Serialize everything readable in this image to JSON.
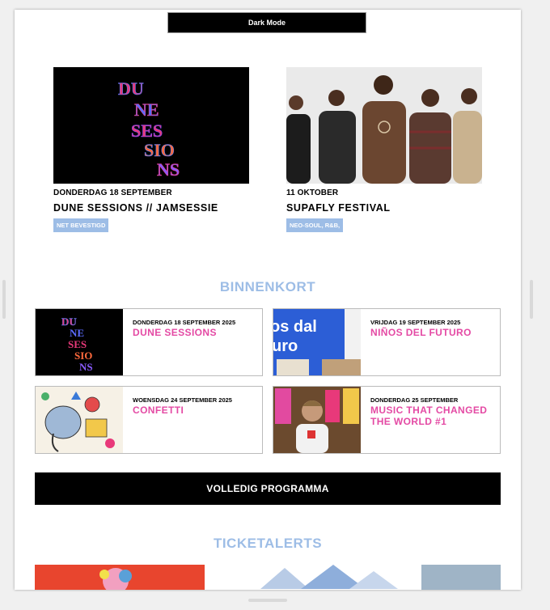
{
  "header": {
    "dark_mode_label": "Dark Mode"
  },
  "featured": [
    {
      "date": "DONDERDAG 18 SEPTEMBER",
      "title": "DUNE SESSIONS // JAMSESSIE",
      "tag": "NET BEVESTIGD",
      "image": "dune-sessions-poster"
    },
    {
      "date": "11 OKTOBER",
      "title": "SUPAFLY FESTIVAL",
      "tag": "NEO-SOUL, R&B,",
      "image": "band-photo"
    }
  ],
  "poster_text": [
    "DU",
    "NE",
    "SES",
    "SIO",
    "NS"
  ],
  "binnenkort": {
    "heading": "BINNENKORT",
    "cards": [
      {
        "date": "DONDERDAG 18 SEPTEMBER 2025",
        "title": "DUNE SESSIONS"
      },
      {
        "date": "VRIJDAG 19 SEPTEMBER 2025",
        "title": "NIÑOS DEL FUTURO",
        "art_text": "os dal",
        "art_text2": "uro"
      },
      {
        "date": "WOENSDAG 24 SEPTEMBER 2025",
        "title": "CONFETTI"
      },
      {
        "date": "DONDERDAG 25 SEPTEMBER",
        "title": "MUSIC THAT CHANGED THE WORLD #1"
      }
    ]
  },
  "program_button": "VOLLEDIG PROGRAMMA",
  "ticketalerts": {
    "heading": "TICKETALERTS"
  },
  "colors": {
    "accent_blue": "#9dbde6",
    "accent_pink": "#e44aa4",
    "black": "#000000"
  }
}
